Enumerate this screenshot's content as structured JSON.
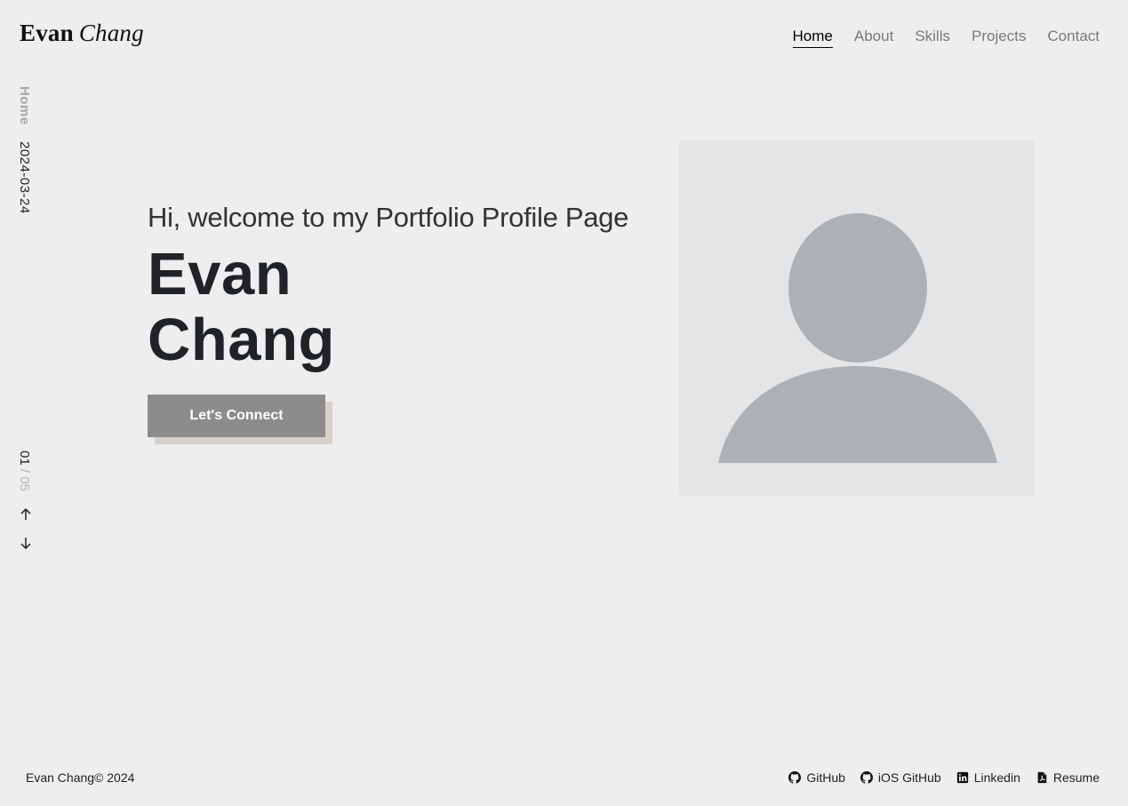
{
  "header": {
    "logo_first": "Evan",
    "logo_last": "Chang",
    "nav": [
      {
        "label": "Home",
        "active": true
      },
      {
        "label": "About",
        "active": false
      },
      {
        "label": "Skills",
        "active": false
      },
      {
        "label": "Projects",
        "active": false
      },
      {
        "label": "Contact",
        "active": false
      }
    ]
  },
  "side": {
    "page_label": "Home",
    "date": "2024-03-24",
    "pager_current": "01",
    "pager_separator": " / ",
    "pager_total": "05",
    "up_icon": "arrow-up-icon",
    "down_icon": "arrow-down-icon"
  },
  "hero": {
    "greeting": "Hi, welcome to my Portfolio Profile Page",
    "name_line1": "Evan",
    "name_line2": "Chang",
    "cta_label": "Let's Connect",
    "avatar_icon": "user-placeholder-icon"
  },
  "footer": {
    "copyright": "Evan Chang© 2024",
    "links": [
      {
        "label": "GitHub",
        "icon": "github-icon"
      },
      {
        "label": "iOS GitHub",
        "icon": "github-icon"
      },
      {
        "label": "Linkedin",
        "icon": "linkedin-icon"
      },
      {
        "label": "Resume",
        "icon": "pdf-file-icon"
      }
    ]
  },
  "colors": {
    "background": "#eeeeee",
    "text_dark": "#1f2226",
    "nav_inactive": "#7a7a7a",
    "button": "#8c8c8c",
    "button_shadow": "#d9d2c9",
    "avatar_bg": "#e4e5e7",
    "avatar_fg": "#adb1b4"
  }
}
